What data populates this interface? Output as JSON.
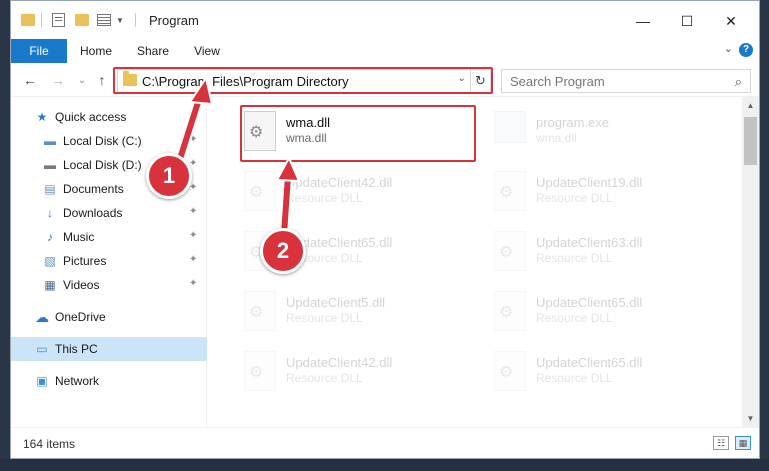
{
  "window": {
    "title": "Program",
    "minimize": "—",
    "maximize": "☐",
    "close": "✕"
  },
  "ribbon": {
    "tabs": [
      "File",
      "Home",
      "Share",
      "View"
    ],
    "expand": "⌄",
    "help": "?"
  },
  "address": {
    "path": "C:\\Program Files\\Program Directory",
    "dropdown": "⌄",
    "refresh": "↻",
    "search_placeholder": "Search Program",
    "search_icon": "search-icon"
  },
  "nav_buttons": {
    "back": "←",
    "forward": "→",
    "recent": "⌄",
    "up": "↑"
  },
  "sidebar": {
    "items": [
      {
        "label": "Quick access",
        "icon": "star-icon",
        "glyph": "★",
        "color": "#2b78d0",
        "pinned": false
      },
      {
        "label": "Local Disk (C:)",
        "icon": "drive-icon",
        "glyph": "▬",
        "color": "#5a8fc4",
        "pinned": true
      },
      {
        "label": "Local Disk (D:)",
        "icon": "drive-icon",
        "glyph": "▬",
        "color": "#7a7a7a",
        "pinned": true
      },
      {
        "label": "Documents",
        "icon": "documents-icon",
        "glyph": "▤",
        "color": "#6a8fb8",
        "pinned": true
      },
      {
        "label": "Downloads",
        "icon": "download-icon",
        "glyph": "↓",
        "color": "#2b78d0",
        "pinned": true
      },
      {
        "label": "Music",
        "icon": "music-icon",
        "glyph": "♪",
        "color": "#2b78d0",
        "pinned": true
      },
      {
        "label": "Pictures",
        "icon": "pictures-icon",
        "glyph": "▧",
        "color": "#5a8fc4",
        "pinned": true
      },
      {
        "label": "Videos",
        "icon": "videos-icon",
        "glyph": "▦",
        "color": "#4d6d8f",
        "pinned": true
      },
      {
        "label": "OneDrive",
        "icon": "cloud-icon",
        "glyph": "☁",
        "color": "#2b78d0",
        "pinned": false
      },
      {
        "label": "This PC",
        "icon": "computer-icon",
        "glyph": "▭",
        "color": "#3d8fd6",
        "pinned": false
      },
      {
        "label": "Network",
        "icon": "network-icon",
        "glyph": "▣",
        "color": "#3d8fd6",
        "pinned": false
      }
    ],
    "pin_glyph": "✦"
  },
  "files": [
    {
      "name": "wma.dll",
      "type": "wma.dll",
      "highlighted": true
    },
    {
      "name": "program.exe",
      "type": "wma.dll",
      "highlighted": false
    },
    {
      "name": "UpdateClient42.dll",
      "type": "Resource DLL",
      "highlighted": false
    },
    {
      "name": "UpdateClient19.dll",
      "type": "Resource DLL",
      "highlighted": false
    },
    {
      "name": "UpdateClient65.dll",
      "type": "Resource DLL",
      "highlighted": false
    },
    {
      "name": "UpdateClient63.dll",
      "type": "Resource DLL",
      "highlighted": false
    },
    {
      "name": "UpdateClient5.dll",
      "type": "Resource DLL",
      "highlighted": false
    },
    {
      "name": "UpdateClient65.dll",
      "type": "Resource DLL",
      "highlighted": false
    },
    {
      "name": "UpdateClient42.dll",
      "type": "Resource DLL",
      "highlighted": false
    },
    {
      "name": "UpdateClient65.dll",
      "type": "Resource DLL",
      "highlighted": false
    }
  ],
  "status": {
    "item_count": "164 items"
  },
  "steps": [
    "1",
    "2"
  ],
  "colors": {
    "accent": "#1979ca",
    "highlight": "#d8323c",
    "selected": "#cce4f7"
  }
}
